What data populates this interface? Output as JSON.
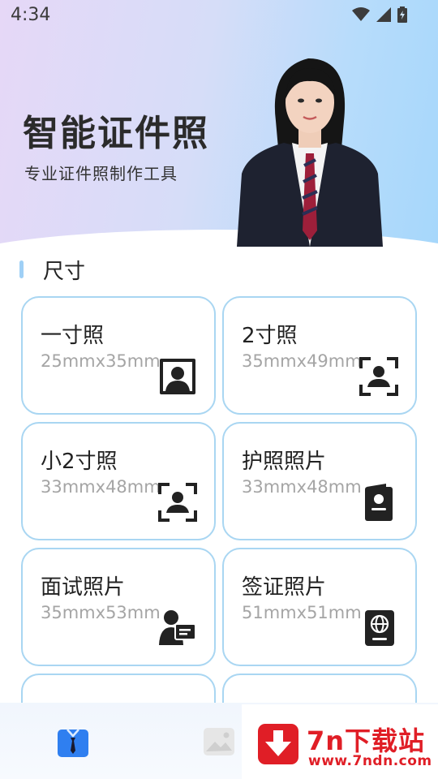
{
  "status_bar": {
    "time": "4:34"
  },
  "hero": {
    "title": "智能证件照",
    "subtitle": "专业证件照制作工具"
  },
  "section": {
    "title": "尺寸"
  },
  "cards": [
    {
      "title": "一寸照",
      "size": "25mmx35mm",
      "icon": "portrait-frame-icon"
    },
    {
      "title": "2寸照",
      "size": "35mmx49mm",
      "icon": "face-scan-icon"
    },
    {
      "title": "小2寸照",
      "size": "33mmx48mm",
      "icon": "face-scan-icon"
    },
    {
      "title": "护照照片",
      "size": "33mmx48mm",
      "icon": "passport-photo-icon"
    },
    {
      "title": "面试照片",
      "size": "35mmx53mm",
      "icon": "interview-icon"
    },
    {
      "title": "签证照片",
      "size": "51mmx51mm",
      "icon": "visa-globe-icon"
    }
  ],
  "bottom_nav": {
    "items": [
      {
        "icon": "id-photo-tab-icon",
        "active": true
      },
      {
        "icon": "album-tab-icon",
        "active": false
      }
    ]
  },
  "watermark": {
    "name": "7n下载站",
    "url": "www.7ndn.com"
  },
  "colors": {
    "accent": "#2f7ff0",
    "card_border": "#a9d6f2",
    "size_text": "#a5a5a5",
    "watermark_red": "#e01e26"
  }
}
